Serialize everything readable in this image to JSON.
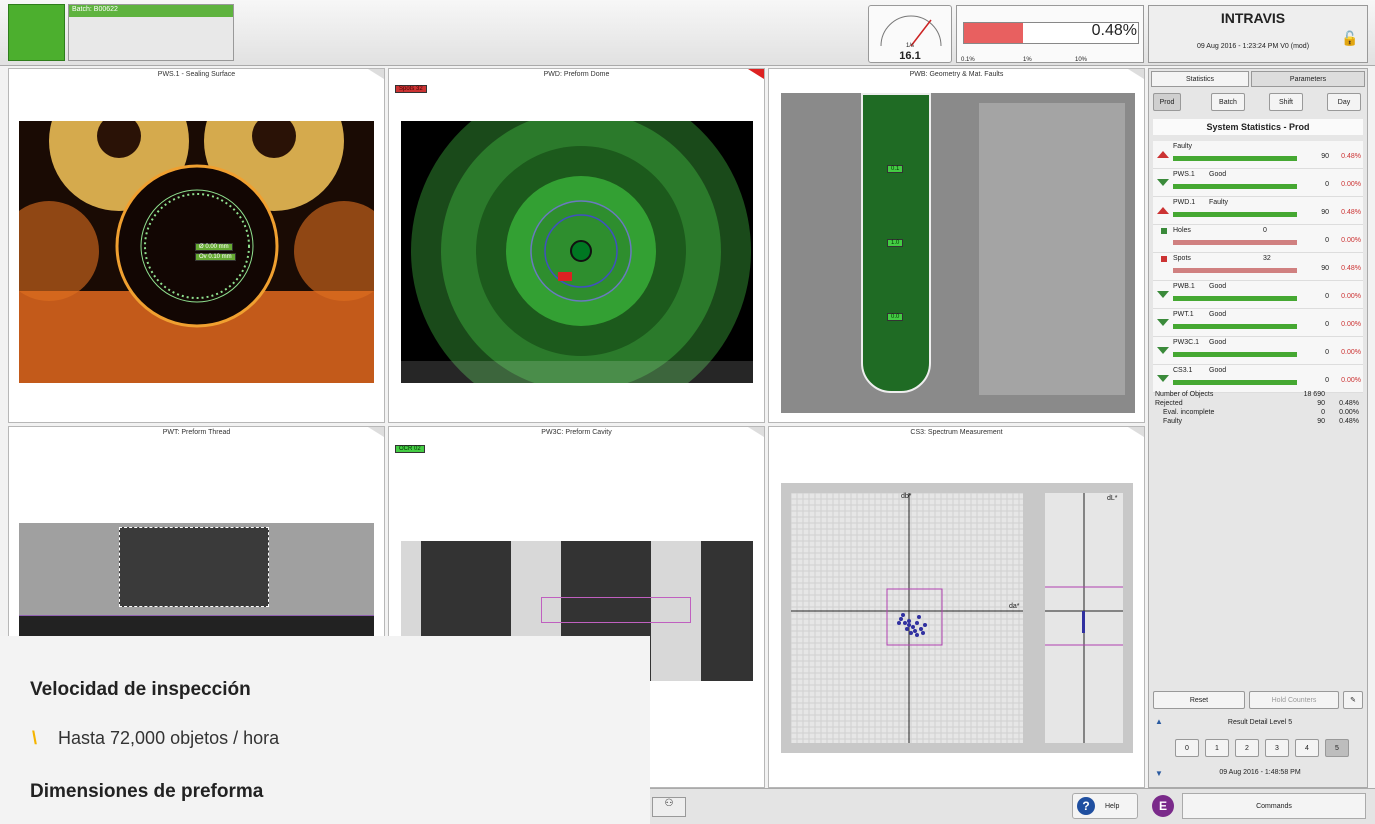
{
  "topbar": {
    "batch_label": "Batch: B00622",
    "gauge_value": "16.1",
    "gauge_unit": "1/s",
    "reject_pct": "0.48%",
    "reject_fraction": 0.48,
    "scale": [
      "0.1%",
      "1%",
      "10%"
    ],
    "brand": "INTRAVIS",
    "timestamp": "09 Aug 2016 - 1:23:24 PM  V0 (mod)"
  },
  "panels": [
    {
      "title": "PWS.1 - Sealing Surface",
      "labels": [
        "Ø 0.00 mm",
        "Ov 0.10 mm"
      ]
    },
    {
      "title": "PWD: Preform Dome",
      "badge": "Spots 32",
      "marker": "32"
    },
    {
      "title": "PWB: Geometry & Mat. Faults",
      "labels": [
        "0.1",
        "1.0",
        "0.0"
      ]
    },
    {
      "title": "PWT: Preform Thread"
    },
    {
      "title": "PW3C: Preform Cavity",
      "badge": "OCR 02"
    },
    {
      "title": "CS3: Spectrum Measurement",
      "y_axis": "db*",
      "x_axis": "da*",
      "y2_axis": "dL*"
    }
  ],
  "sidebar": {
    "tabs": [
      "Statistics",
      "Parameters"
    ],
    "buttons": [
      "Prod",
      "Batch",
      "Shift",
      "Day"
    ],
    "header": "System Statistics - Prod",
    "rows": [
      {
        "label": "Faulty",
        "status": "",
        "value": "90",
        "pct": "0.48%",
        "dir": "up"
      },
      {
        "label": "PWS.1",
        "status": "Good",
        "value": "0",
        "pct": "0.00%",
        "dir": "down"
      },
      {
        "label": "PWD.1",
        "status": "Faulty",
        "value": "90",
        "pct": "0.48%",
        "dir": "up"
      },
      {
        "label": "Holes",
        "status": "0",
        "value": "0",
        "pct": "0.00%",
        "dir": "sub"
      },
      {
        "label": "Spots",
        "status": "32",
        "value": "90",
        "pct": "0.48%",
        "dir": "sub"
      },
      {
        "label": "PWB.1",
        "status": "Good",
        "value": "0",
        "pct": "0.00%",
        "dir": "down"
      },
      {
        "label": "PWT.1",
        "status": "Good",
        "value": "0",
        "pct": "0.00%",
        "dir": "down"
      },
      {
        "label": "PW3C.1",
        "status": "Good",
        "value": "0",
        "pct": "0.00%",
        "dir": "down"
      },
      {
        "label": "CS3.1",
        "status": "Good",
        "value": "0",
        "pct": "0.00%",
        "dir": "down"
      }
    ],
    "counts": [
      {
        "label": "Number of Objects",
        "value": "18 690",
        "pct": ""
      },
      {
        "label": "Rejected",
        "value": "90",
        "pct": "0.48%"
      },
      {
        "label": "Eval. incomplete",
        "value": "0",
        "pct": "0.00%"
      },
      {
        "label": "Faulty",
        "value": "90",
        "pct": "0.48%"
      }
    ],
    "reset": "Reset",
    "hold": "Hold Counters",
    "detail_title": "Result Detail Level 5",
    "levels": [
      "0",
      "1",
      "2",
      "3",
      "4",
      "5"
    ],
    "detail_ts": "09 Aug 2016 - 1:48:58 PM"
  },
  "bottombar": {
    "help": "Help",
    "commands": "Commands",
    "e": "E"
  },
  "overlay": {
    "h1": "Velocidad de inspección",
    "item": "Hasta 72,000 objetos / hora",
    "h2": "Dimensiones de preforma"
  }
}
